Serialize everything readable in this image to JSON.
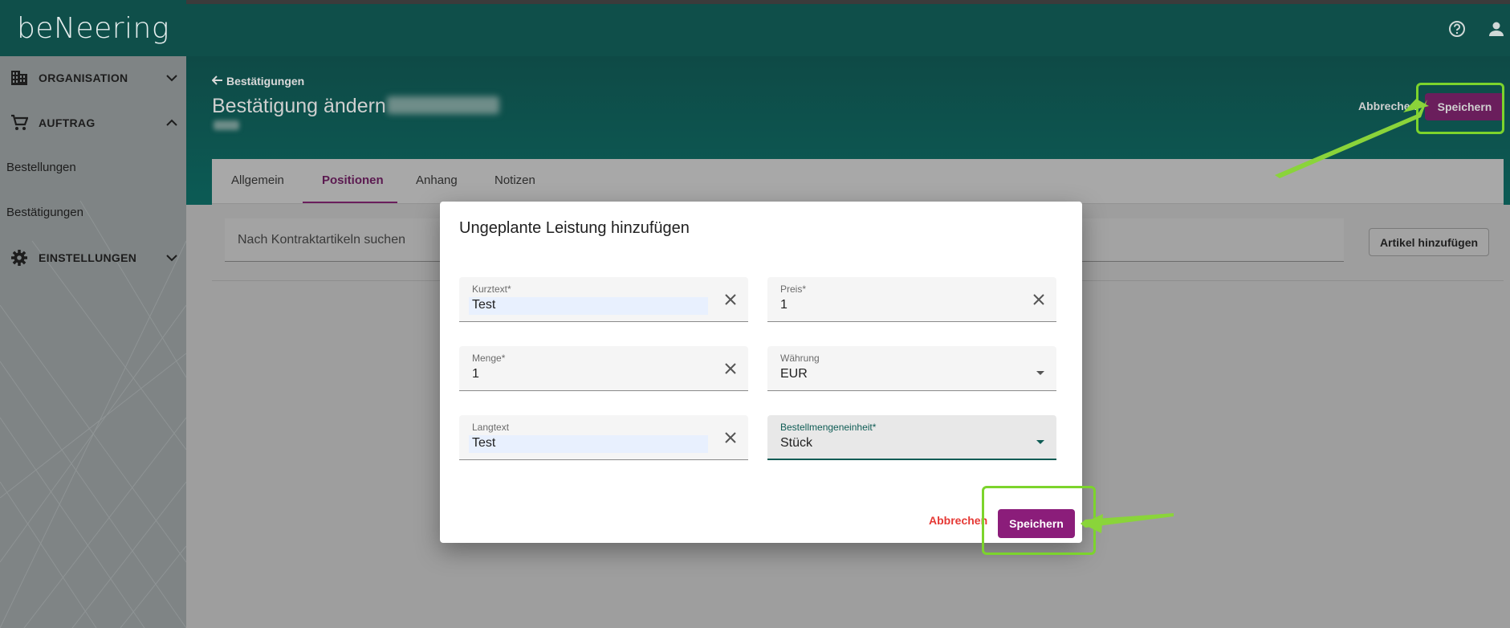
{
  "app": {
    "logo_text": "beNeering"
  },
  "sidebar": {
    "sections": [
      {
        "label": "ORGANISATION",
        "icon": "building-icon",
        "expanded": false
      },
      {
        "label": "AUFTRAG",
        "icon": "cart-icon",
        "expanded": true
      },
      {
        "label": "EINSTELLUNGEN",
        "icon": "gear-icon",
        "expanded": false
      }
    ],
    "sub_items": [
      "Bestellungen",
      "Bestätigungen"
    ]
  },
  "topbar": {
    "icons": [
      "help-icon",
      "user-icon"
    ]
  },
  "header": {
    "back_label": "Bestätigungen",
    "title": "Bestätigung ändern",
    "cancel_label": "Abbrechen",
    "save_label": "Speichern"
  },
  "tabs": [
    {
      "label": "Allgemein",
      "active": false
    },
    {
      "label": "Positionen",
      "active": true
    },
    {
      "label": "Anhang",
      "active": false
    },
    {
      "label": "Notizen",
      "active": false
    }
  ],
  "positions": {
    "search_placeholder": "Nach Kontraktartikeln suchen",
    "add_article_label": "Artikel hinzufügen"
  },
  "dialog": {
    "title": "Ungeplante Leistung hinzufügen",
    "fields": {
      "kurztext": {
        "label": "Kurztext*",
        "value": "Test"
      },
      "preis": {
        "label": "Preis*",
        "value": "1"
      },
      "menge": {
        "label": "Menge*",
        "value": "1"
      },
      "waehrung": {
        "label": "Währung",
        "value": "EUR"
      },
      "langtext": {
        "label": "Langtext",
        "value": "Test"
      },
      "einheit": {
        "label": "Bestellmengeneinheit*",
        "value": "Stück"
      }
    },
    "cancel_label": "Abbrechen",
    "save_label": "Speichern"
  },
  "colors": {
    "header_teal": "#0f4f4a",
    "primary_purple": "#8b1d7a",
    "cancel_red": "#e53935",
    "highlight_green": "#7cd42c"
  }
}
